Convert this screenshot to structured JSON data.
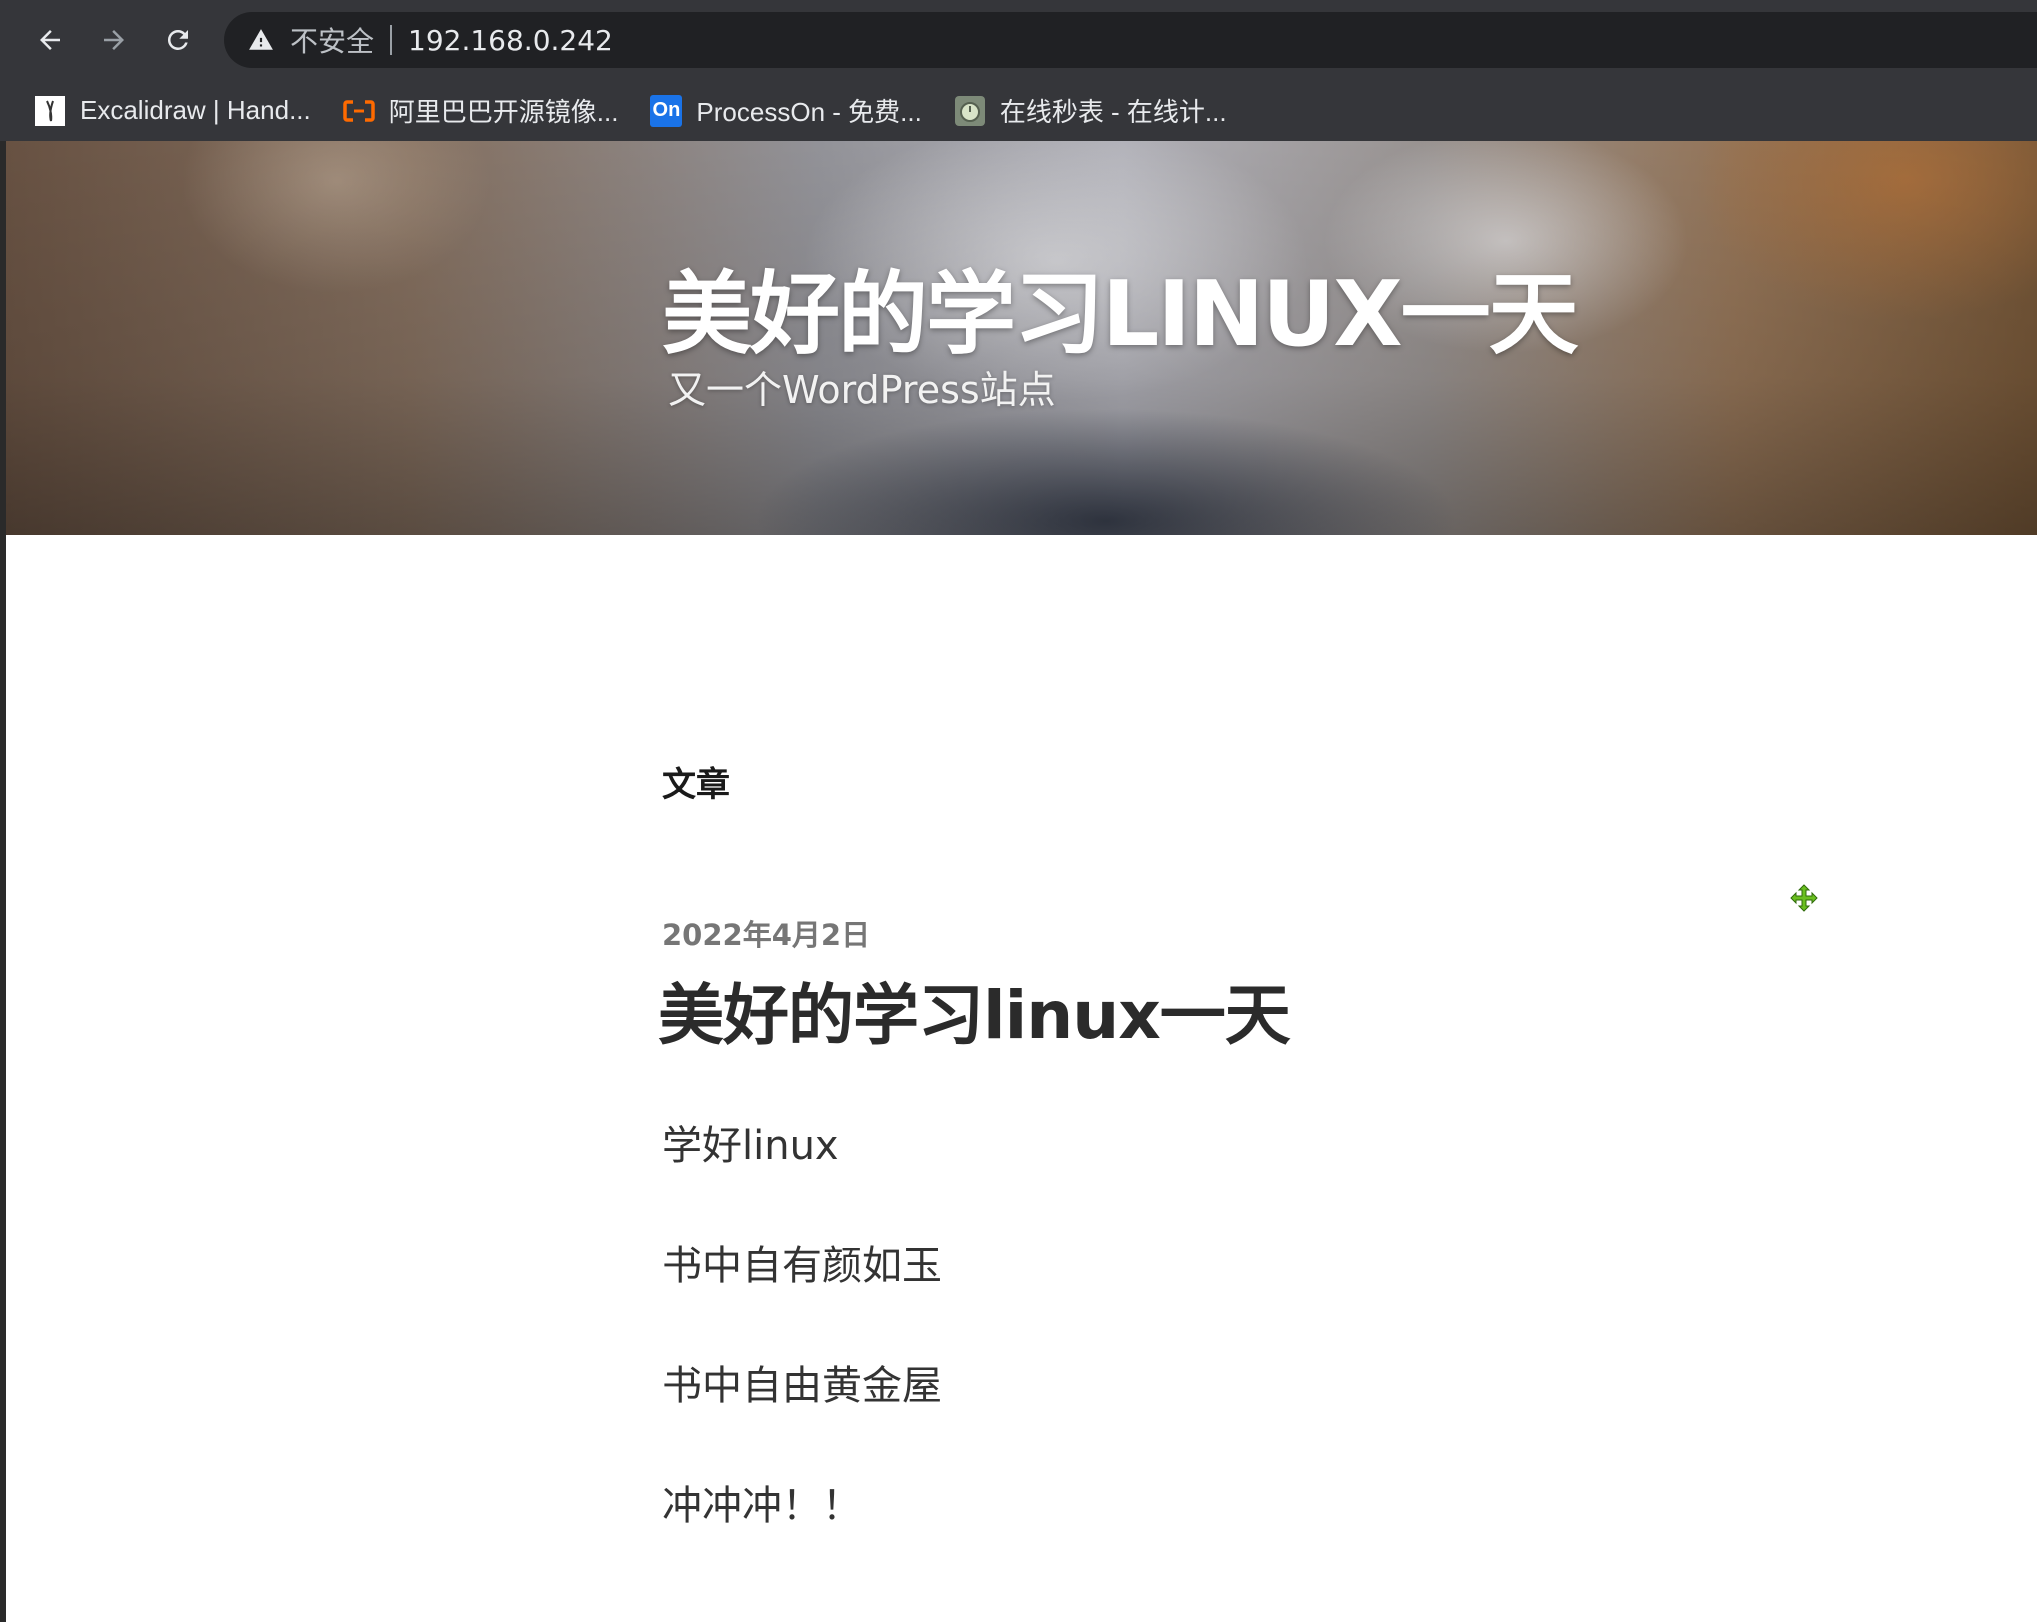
{
  "browser": {
    "security_label": "不安全",
    "url": "192.168.0.242",
    "icons": {
      "back": "arrow-left-icon",
      "forward": "arrow-right-icon",
      "reload": "reload-icon",
      "warning": "warning-triangle-icon"
    },
    "bookmarks": [
      {
        "label": "Excalidraw | Hand...",
        "icon": "excalidraw-icon"
      },
      {
        "label": "阿里巴巴开源镜像...",
        "icon": "aliyun-icon",
        "icon_color": "#ff6a00"
      },
      {
        "label": "ProcessOn - 免费...",
        "icon": "processon-icon",
        "icon_text": "On",
        "icon_color": "#1a73e8"
      },
      {
        "label": "在线秒表 - 在线计...",
        "icon": "stopwatch-icon"
      }
    ]
  },
  "site": {
    "title": "美好的学习LINUX一天",
    "tagline": "又一个WordPress站点"
  },
  "main": {
    "section_heading": "文章",
    "post": {
      "date": "2022年4月2日",
      "title": "美好的学习linux一天",
      "paragraphs": [
        "学好linux",
        "书中自有颜如玉",
        "书中自由黄金屋",
        "冲冲冲！！"
      ]
    }
  },
  "colors": {
    "chrome_bg": "#35363a",
    "omnibox_bg": "#202124",
    "cursor_green": "#6abf1f"
  }
}
